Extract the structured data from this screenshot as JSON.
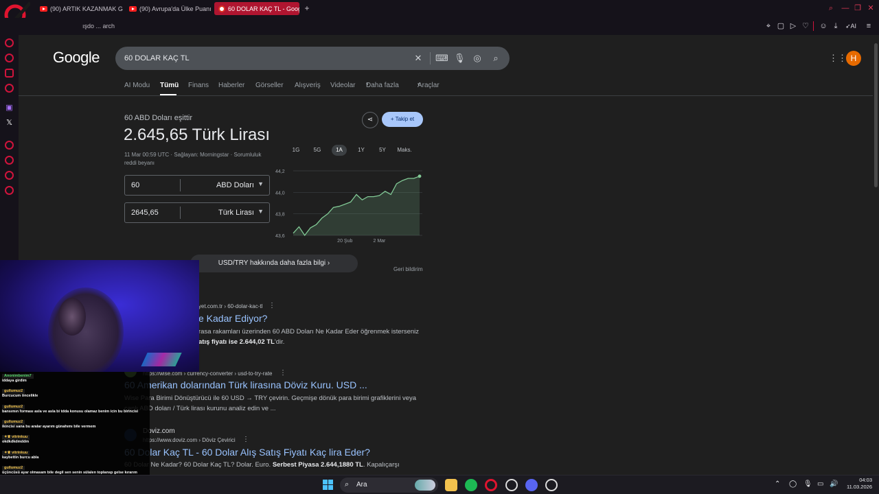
{
  "browser": {
    "tabs": [
      {
        "title": "(90) ARTIK KAZANMAK G"
      },
      {
        "title": "(90) Avrupa'da Ülke Puanı"
      },
      {
        "title": "60 DOLAR KAÇ TL - Goog"
      }
    ],
    "address": "ışdo ... arch"
  },
  "google": {
    "logo": "Google",
    "query": "60 DOLAR KAÇ TL",
    "avatar_letter": "H",
    "tabs": [
      "AI Modu",
      "Tümü",
      "Finans",
      "Haberler",
      "Görseller",
      "Alışveriş",
      "Videolar",
      "Daha fazla",
      "Araçlar"
    ],
    "currency": {
      "label": "60 ABD Doları eşittir",
      "value": "2.645,65 Türk Lirası",
      "meta": "11 Mar 00:59 UTC · Sağlayan: Morningstar · Sorumluluk reddi beyanı",
      "from_amount": "60",
      "from_unit": "ABD Doları",
      "to_amount": "2645,65",
      "to_unit": "Türk Lirası",
      "follow": "Takip et",
      "ranges": [
        "1G",
        "5G",
        "1A",
        "1Y",
        "5Y",
        "Maks."
      ],
      "more_info": "USD/TRY hakkında daha fazla bilgi",
      "feedback": "Geri bildirim"
    },
    "results": [
      {
        "url": "yet.com.tr › 60-dolar-kac-tl",
        "title": "e Kadar Ediyor?",
        "snippet_1": "rasa rakamları üzerinden 60 ABD Doları Ne Kadar Eder öğrenmek isterseniz",
        "snippet_2_bold": "atış fiyatı ise 2.644,02 TL",
        "snippet_2_rest": "'dir."
      },
      {
        "url": "https://wise.com › currency-converter › usd-to-try-rate",
        "title": "60 Amerikan dolarından Türk lirasına Döviz Kuru. USD ...",
        "snippet_1": "Wise Para Birimi Dönüştürücü ile 60 USD → TRY çevirin. Geçmişe dönük para birimi grafiklerini veya",
        "snippet_2": "canlı ABD doları / Türk lirası kurunu analiz edin ve ..."
      },
      {
        "site": "Doviz.com",
        "url": "https://www.doviz.com › Döviz Çevirici",
        "title": "60 Dolar Kaç TL - 60 Dolar Alış Satış Fiyatı Kaç lira Eder?",
        "snippet_pre": "60 Dolar Ne Kadar? 60 Dolar Kaç TL? Dolar. Euro. ",
        "snippet_bold": "Serbest Piyasa 2.644,1880 TL",
        "snippet_post": ". Kapalıçarşı"
      }
    ]
  },
  "chart_data": {
    "type": "line",
    "x": [
      "9 Şub",
      "10 Şub",
      "11 Şub",
      "12 Şub",
      "13 Şub",
      "16 Şub",
      "17 Şub",
      "18 Şub",
      "19 Şub",
      "20 Şub",
      "23 Şub",
      "24 Şub",
      "25 Şub",
      "26 Şub",
      "27 Şub",
      "2 Mar",
      "3 Mar",
      "4 Mar",
      "5 Mar",
      "6 Mar",
      "9 Mar",
      "10 Mar",
      "11 Mar"
    ],
    "y": [
      43.62,
      43.68,
      43.6,
      43.67,
      43.7,
      43.76,
      43.8,
      43.86,
      43.87,
      43.89,
      43.91,
      43.98,
      43.93,
      43.96,
      43.96,
      43.97,
      44.01,
      43.98,
      44.08,
      44.11,
      44.13,
      44.13,
      44.15
    ],
    "x_ticks": [
      "20 Şub",
      "2 Mar"
    ],
    "y_ticks": [
      "43,6",
      "43,8",
      "44,0",
      "44,2"
    ],
    "ylim": [
      43.6,
      44.2
    ],
    "grid": true,
    "color": "#81c995"
  },
  "chat": [
    {
      "user": "Anonimbenim7",
      "text": "iddaya girdim",
      "color": "green"
    },
    {
      "user": "gullumuz2",
      "text": "Burcucum öncelikle"
    },
    {
      "user": "gullumuz2",
      "text": "bansımın forması asla ve asla bi tdda konusu olamaz benim icin bu birincisi"
    },
    {
      "user": "gullumuz2",
      "text": "ikincisi sana bu aralar ayarım günahımı bile vermem"
    },
    {
      "user": "✦♛ vitrinkuu",
      "text": "okdkdkdmddm"
    },
    {
      "user": "✦♛ vitrinkuu",
      "text": "kaybettin burcu abla"
    },
    {
      "user": "gullumuz2",
      "text": "üçüncüsü ayar olmasam bile degil sen senin sülalen toplansp gelse kırarım"
    },
    {
      "user": "gullumuz2",
      "text": ""
    }
  ],
  "taskbar": {
    "search": "Ara",
    "time": "04:03",
    "date": "11.03.2026"
  }
}
